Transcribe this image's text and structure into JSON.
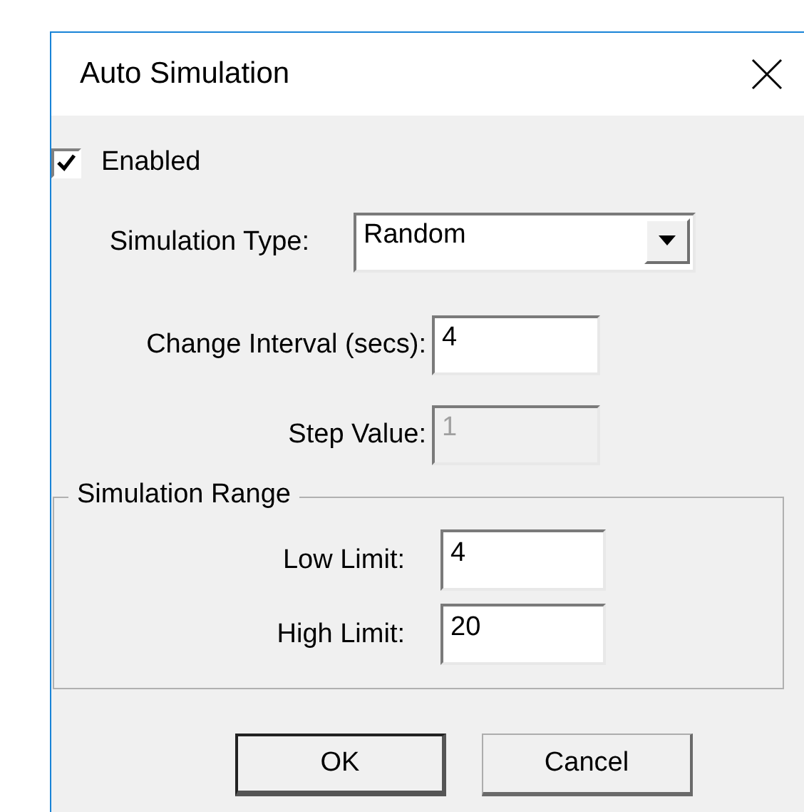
{
  "window": {
    "title": "Auto Simulation"
  },
  "enabled": {
    "label": "Enabled",
    "checked": true
  },
  "fields": [
    {
      "kind": "dropdown",
      "label": "Simulation Type:",
      "value": "Random",
      "disabled": false
    },
    {
      "kind": "text",
      "label": "Change Interval (secs):",
      "value": "4",
      "disabled": false
    },
    {
      "kind": "text",
      "label": "Step Value:",
      "value": "1",
      "disabled": true
    }
  ],
  "simulation_range": {
    "title": "Simulation Range",
    "fields": [
      {
        "kind": "text",
        "label": "Low Limit:",
        "value": "4",
        "disabled": false
      },
      {
        "kind": "text",
        "label": "High Limit:",
        "value": "20",
        "disabled": false
      }
    ]
  },
  "buttons": [
    {
      "label": "OK",
      "default": true
    },
    {
      "label": "Cancel",
      "default": false
    }
  ]
}
